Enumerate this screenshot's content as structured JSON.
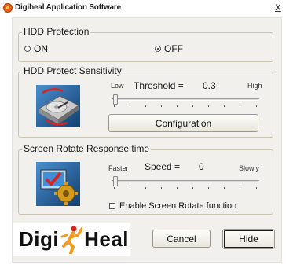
{
  "window": {
    "title": "Digiheal Application Software",
    "close_label": "x"
  },
  "hdd_protection": {
    "legend": "HDD Protection",
    "on_label": "ON",
    "off_label": "OFF",
    "selected": "OFF"
  },
  "sensitivity": {
    "legend": "HDD Protect Sensitivity",
    "low_label": "Low",
    "high_label": "High",
    "threshold_label": "Threshold =",
    "threshold_value": "0.3",
    "slider_level": 0,
    "configuration_button": "Configuration"
  },
  "screen_rotate": {
    "legend": "Screen Rotate Response time",
    "faster_label": "Faster",
    "slowly_label": "Slowly",
    "speed_label": "Speed =",
    "speed_value": "0",
    "slider_level": 0,
    "enable_label": "Enable Screen Rotate function",
    "enable_checked": false
  },
  "footer": {
    "logo_text_left": "Digi",
    "logo_text_right": "Heal",
    "cancel_button": "Cancel",
    "hide_button": "Hide"
  },
  "colors": {
    "accent_logo": "#f29b1e",
    "logo_red": "#d9241c",
    "panel_bg": "#f1f0ec"
  }
}
